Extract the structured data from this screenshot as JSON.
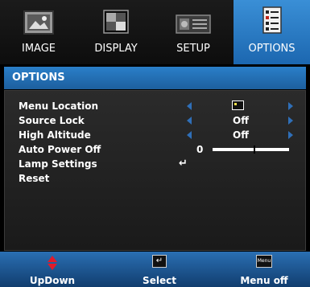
{
  "tabs": [
    {
      "label": "IMAGE",
      "icon": "image-icon"
    },
    {
      "label": "DISPLAY",
      "icon": "display-icon"
    },
    {
      "label": "SETUP",
      "icon": "setup-icon"
    },
    {
      "label": "OPTIONS",
      "icon": "options-icon",
      "active": true
    }
  ],
  "title": "OPTIONS",
  "menu": [
    {
      "label": "Menu Location",
      "value_icon": "menu-location-icon"
    },
    {
      "label": "Source Lock",
      "value": "Off"
    },
    {
      "label": "High Altitude",
      "value": "Off"
    },
    {
      "label": "Auto Power Off",
      "slider_value_text": "0",
      "slider_level": 0.55
    },
    {
      "label": "Lamp Settings",
      "enter_symbol": "↵"
    },
    {
      "label": "Reset"
    }
  ],
  "footer": {
    "updown_label": "UpDown",
    "select_label": "Select",
    "select_key": "↵",
    "menuoff_label": "Menu off",
    "menu_key": "Menu"
  },
  "colors": {
    "accent": "#1f6db5",
    "arrow": "#2f6fb8",
    "updown": "#e21b2b"
  }
}
